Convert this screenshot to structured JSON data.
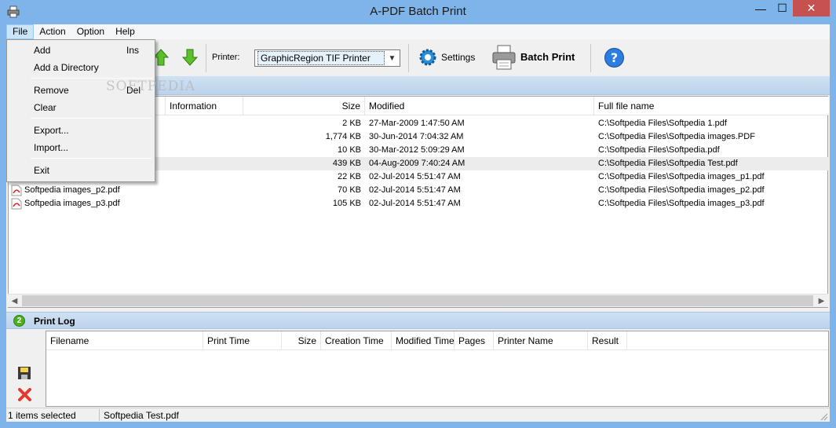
{
  "window": {
    "title": "A-PDF Batch Print",
    "minimize_glyph": "—",
    "maximize_glyph": "☐",
    "close_glyph": "✕"
  },
  "menubar": [
    "File",
    "Action",
    "Option",
    "Help"
  ],
  "file_menu": [
    {
      "label": "Add",
      "key": "Ins"
    },
    {
      "label": "Add a Directory",
      "key": ""
    },
    {
      "label": "Remove",
      "key": "Del"
    },
    {
      "label": "Clear",
      "key": ""
    },
    {
      "label": "Export...",
      "key": ""
    },
    {
      "label": "Import...",
      "key": ""
    },
    {
      "label": "Exit",
      "key": ""
    }
  ],
  "toolbar": {
    "printer_label": "Printer:",
    "printer_value": "GraphicRegion TIF Printer",
    "settings_label": "Settings",
    "batch_print_label": "Batch Print"
  },
  "watermark": "SOFTPEDIA",
  "file_columns": [
    "Information",
    "Size",
    "Modified",
    "Full file name"
  ],
  "files": [
    {
      "name": "",
      "size": "2 KB",
      "modified": "27-Mar-2009 1:47:50 AM",
      "path": "C:\\Softpedia Files\\Softpedia 1.pdf"
    },
    {
      "name": "",
      "size": "1,774 KB",
      "modified": "30-Jun-2014 7:04:32 AM",
      "path": "C:\\Softpedia Files\\Softpedia images.PDF"
    },
    {
      "name": "",
      "size": "10 KB",
      "modified": "30-Mar-2012 5:09:29 AM",
      "path": "C:\\Softpedia Files\\Softpedia.pdf"
    },
    {
      "name": "",
      "size": "439 KB",
      "modified": "04-Aug-2009 7:40:24 AM",
      "path": "C:\\Softpedia Files\\Softpedia Test.pdf"
    },
    {
      "name": "",
      "size": "22 KB",
      "modified": "02-Jul-2014 5:51:47 AM",
      "path": "C:\\Softpedia Files\\Softpedia images_p1.pdf"
    },
    {
      "name": "Softpedia images_p2.pdf",
      "size": "70 KB",
      "modified": "02-Jul-2014 5:51:47 AM",
      "path": "C:\\Softpedia Files\\Softpedia images_p2.pdf"
    },
    {
      "name": "Softpedia images_p3.pdf",
      "size": "105 KB",
      "modified": "02-Jul-2014 5:51:47 AM",
      "path": "C:\\Softpedia Files\\Softpedia images_p3.pdf"
    }
  ],
  "log": {
    "title": "Print Log",
    "badge": "2",
    "columns": [
      "Filename",
      "Print Time",
      "Size",
      "Creation Time",
      "Modified Time",
      "Pages",
      "Printer Name",
      "Result"
    ]
  },
  "status": {
    "selected": "1 items selected",
    "current_file": "Softpedia Test.pdf"
  },
  "colors": {
    "titlebar": "#7eb4ea",
    "close": "#c75050",
    "band": "#c5daf0",
    "selected_row": "#ececec"
  }
}
